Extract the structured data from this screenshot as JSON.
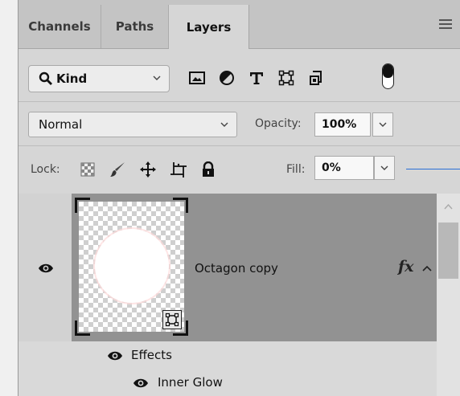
{
  "tabs": [
    {
      "label": "Channels",
      "active": false
    },
    {
      "label": "Paths",
      "active": false
    },
    {
      "label": "Layers",
      "active": true
    }
  ],
  "filter": {
    "kind_label": "Kind",
    "icons": [
      "image-filter-icon",
      "adjustment-filter-icon",
      "type-filter-icon",
      "shape-filter-icon",
      "smart-object-filter-icon",
      "filter-toggle-icon"
    ]
  },
  "blend": {
    "mode": "Normal",
    "opacity_label": "Opacity:",
    "opacity_value": "100%"
  },
  "lock": {
    "label": "Lock:",
    "icons": [
      "lock-transparent-pixels-icon",
      "lock-image-pixels-icon",
      "lock-position-icon",
      "lock-artboard-icon",
      "lock-all-icon"
    ],
    "fill_label": "Fill:",
    "fill_value": "0%"
  },
  "layers": [
    {
      "name": "Octagon copy",
      "visible": true,
      "has_effects": true,
      "fx_label": "fx"
    }
  ],
  "effects": {
    "label": "Effects",
    "items": [
      {
        "label": "Inner Glow"
      }
    ]
  },
  "colors": {
    "accent_line": "#2a6fd6",
    "selected_row": "#929292"
  }
}
